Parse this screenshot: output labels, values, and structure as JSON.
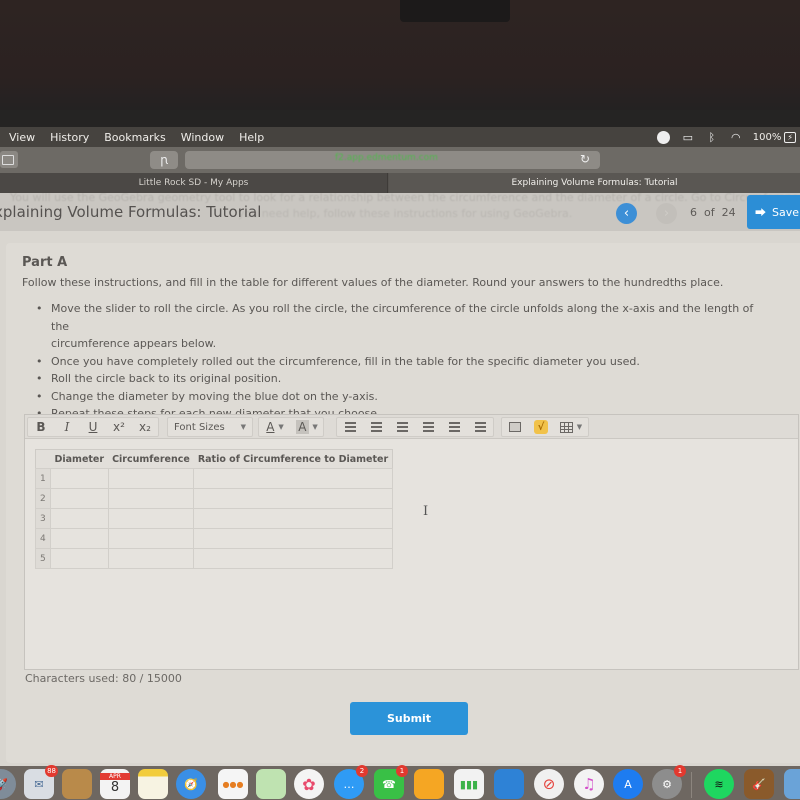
{
  "menubar": {
    "items": [
      "View",
      "History",
      "Bookmarks",
      "Window",
      "Help"
    ],
    "battery": "100%",
    "battery_badge": "⚡"
  },
  "browser": {
    "url": "f2.app.edmentum.com",
    "tabs": [
      {
        "label": "Little Rock SD - My Apps",
        "active": false
      },
      {
        "label": "Explaining Volume Formulas: Tutorial",
        "active": true
      }
    ]
  },
  "header": {
    "title": "xplaining Volume Formulas: Tutorial",
    "ghost_line1": "You will use the GeoGebra geometry tool to look for a relationship between the circumference and the diameter of a circle. Go to Circumference",
    "ghost_line2": "you need help, follow these instructions for using GeoGebra.",
    "prev_label": "‹",
    "next_label": "›",
    "page_current": "6",
    "page_of": "of",
    "page_total": "24",
    "save_label": "Save &"
  },
  "part": {
    "title": "Part A",
    "instructions": "Follow these instructions, and fill in the table for different values of the diameter. Round your answers to the hundredths place.",
    "bullets": [
      {
        "text": "Move the slider to roll the circle. As you roll the circle, the circumference of the circle unfolds along the x-axis and the length of the",
        "cont": "circumference appears below."
      },
      {
        "text": "Once you have completely rolled out the circumference, fill in the table for the specific diameter you used.",
        "cont": ""
      },
      {
        "text": "Roll the circle back to its original position.",
        "cont": ""
      },
      {
        "text": "Change the diameter by moving the blue dot on the y-axis.",
        "cont": ""
      },
      {
        "text": "Repeat these steps for each new diameter that you choose.",
        "cont": ""
      }
    ]
  },
  "editor": {
    "toolbar": {
      "bold": "B",
      "italic": "I",
      "underline": "U",
      "superscript": "x²",
      "subscript": "x₂",
      "font_sizes": "Font Sizes",
      "text_color": "A",
      "bg_color": "A"
    },
    "table": {
      "headers": [
        "Diameter",
        "Circumference",
        "Ratio of Circumference to Diameter"
      ],
      "rows": [
        {
          "num": "1",
          "diameter": "",
          "circumference": "",
          "ratio": ""
        },
        {
          "num": "2",
          "diameter": "",
          "circumference": "",
          "ratio": ""
        },
        {
          "num": "3",
          "diameter": "",
          "circumference": "",
          "ratio": ""
        },
        {
          "num": "4",
          "diameter": "",
          "circumference": "",
          "ratio": ""
        },
        {
          "num": "5",
          "diameter": "",
          "circumference": "",
          "ratio": ""
        }
      ]
    }
  },
  "footer": {
    "char_count": "Characters used: 80 / 15000",
    "submit_label": "Submit"
  },
  "dock": {
    "items": [
      {
        "name": "launchpad",
        "badge": ""
      },
      {
        "name": "mail",
        "badge": "88"
      },
      {
        "name": "contacts",
        "badge": ""
      },
      {
        "name": "calendar",
        "month": "APR",
        "day": "8",
        "badge": ""
      },
      {
        "name": "notes",
        "badge": ""
      },
      {
        "name": "safari",
        "badge": ""
      },
      {
        "name": "reminders",
        "badge": ""
      },
      {
        "name": "maps",
        "badge": ""
      },
      {
        "name": "photos",
        "badge": ""
      },
      {
        "name": "messages",
        "badge": "2"
      },
      {
        "name": "facetime",
        "badge": "1"
      },
      {
        "name": "pages",
        "badge": ""
      },
      {
        "name": "numbers",
        "badge": ""
      },
      {
        "name": "keynote",
        "badge": ""
      },
      {
        "name": "news",
        "badge": ""
      },
      {
        "name": "music",
        "badge": ""
      },
      {
        "name": "app-store",
        "badge": ""
      },
      {
        "name": "system-preferences",
        "badge": "1"
      },
      {
        "name": "spotify",
        "badge": ""
      },
      {
        "name": "garageband",
        "badge": ""
      }
    ]
  },
  "colors": {
    "accent": "#2c8ed6",
    "sqrt_icon": "#f1c24a"
  }
}
